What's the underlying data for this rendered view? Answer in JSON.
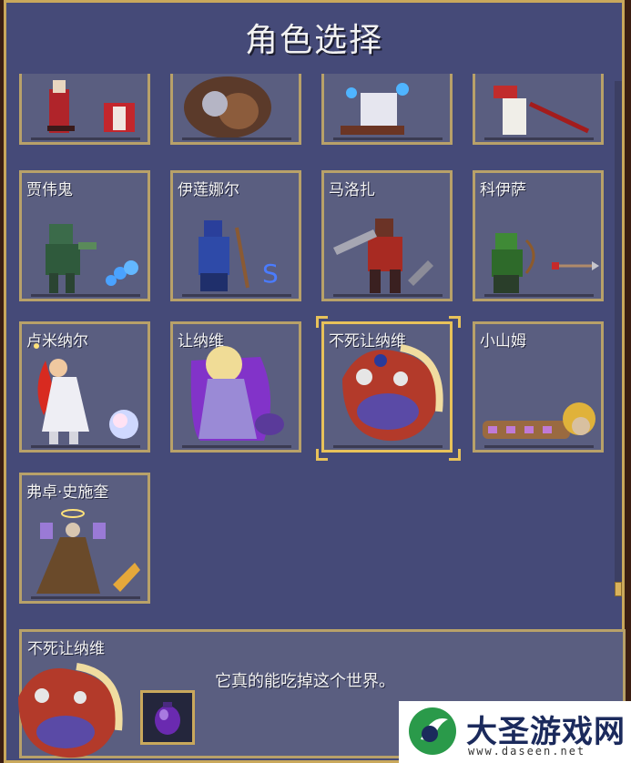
{
  "screen": {
    "title": "角色选择"
  },
  "characters": [
    {
      "name": "",
      "state": "partial"
    },
    {
      "name": "",
      "state": "partial"
    },
    {
      "name": "",
      "state": "partial"
    },
    {
      "name": "",
      "state": "partial"
    },
    {
      "name": "贾伟鬼"
    },
    {
      "name": "伊莲娜尔"
    },
    {
      "name": "马洛扎"
    },
    {
      "name": "科伊萨"
    },
    {
      "name": "卢米纳尔"
    },
    {
      "name": "让纳维"
    },
    {
      "name": "不死让纳维",
      "selected": true
    },
    {
      "name": "小山姆"
    },
    {
      "name": "弗卓·史施奎"
    }
  ],
  "detail": {
    "name": "不死让纳维",
    "description": "它真的能吃掉这个世界。"
  },
  "watermark": {
    "brand": "大圣游戏网",
    "url": "www.daseen.net"
  },
  "colors": {
    "panel": "#454a78",
    "card": "#5a5e80",
    "border": "#b8a169",
    "accent": "#e8c25a"
  }
}
